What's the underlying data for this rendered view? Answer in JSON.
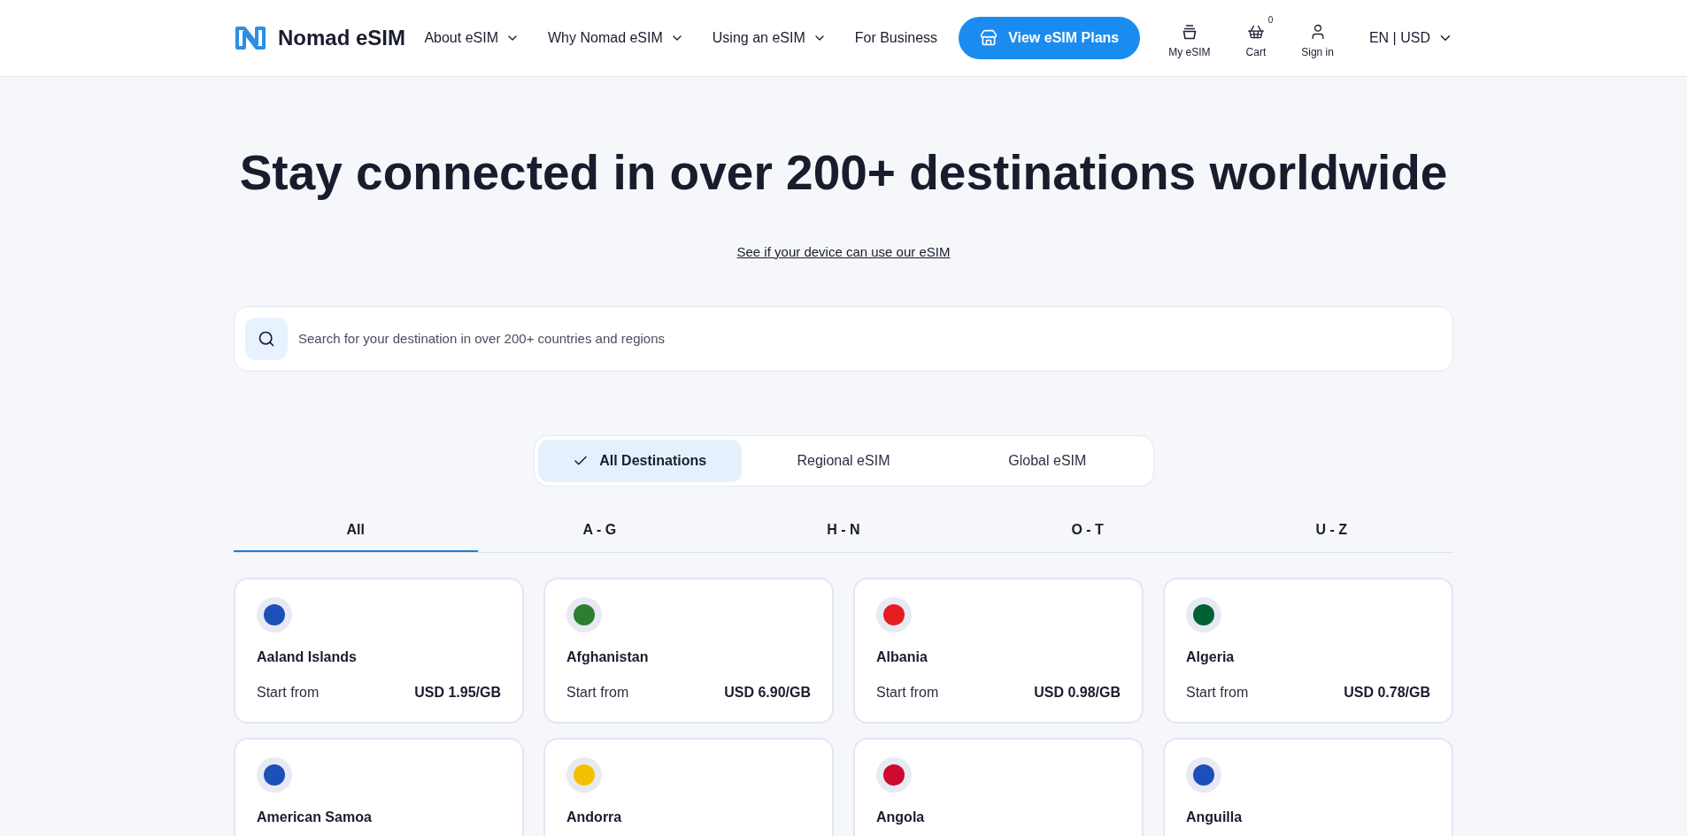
{
  "header": {
    "logo": "Nomad eSIM",
    "nav": [
      {
        "label": "About eSIM",
        "dropdown": true
      },
      {
        "label": "Why Nomad eSIM",
        "dropdown": true
      },
      {
        "label": "Using an eSIM",
        "dropdown": true
      },
      {
        "label": "For Business",
        "dropdown": false
      }
    ],
    "cta": "View eSIM Plans",
    "icons": [
      {
        "kind": "esim",
        "label": "My eSIM"
      },
      {
        "kind": "cart",
        "label": "Cart",
        "badge": "0"
      },
      {
        "kind": "user",
        "label": "Sign in"
      }
    ],
    "locale": "EN | USD"
  },
  "hero": {
    "title": "Stay connected in over 200+ destinations worldwide",
    "link": "See if your device can use our eSIM"
  },
  "search": {
    "placeholder": "Search for your destination in over 200+ countries and regions"
  },
  "segments": [
    {
      "label": "All Destinations",
      "selected": true
    },
    {
      "label": "Regional eSIM",
      "selected": false
    },
    {
      "label": "Global eSIM",
      "selected": false
    }
  ],
  "letter_tabs": [
    {
      "label": "All",
      "selected": true
    },
    {
      "label": "A - G",
      "selected": false
    },
    {
      "label": "H - N",
      "selected": false
    },
    {
      "label": "O - T",
      "selected": false
    },
    {
      "label": "U - Z",
      "selected": false
    }
  ],
  "destinations": [
    {
      "name": "Aaland Islands",
      "from": "Start from",
      "price": "USD 1.95/GB",
      "color": "#1d4fb8"
    },
    {
      "name": "Afghanistan",
      "from": "Start from",
      "price": "USD 6.90/GB",
      "color": "#2e7d32"
    },
    {
      "name": "Albania",
      "from": "Start from",
      "price": "USD 0.98/GB",
      "color": "#e41e20"
    },
    {
      "name": "Algeria",
      "from": "Start from",
      "price": "USD 0.78/GB",
      "color": "#006233"
    },
    {
      "name": "American Samoa",
      "color": "#1d4fb8"
    },
    {
      "name": "Andorra",
      "color": "#f2c200"
    },
    {
      "name": "Angola",
      "color": "#cc092f"
    },
    {
      "name": "Anguilla",
      "color": "#1d4fb8"
    }
  ]
}
